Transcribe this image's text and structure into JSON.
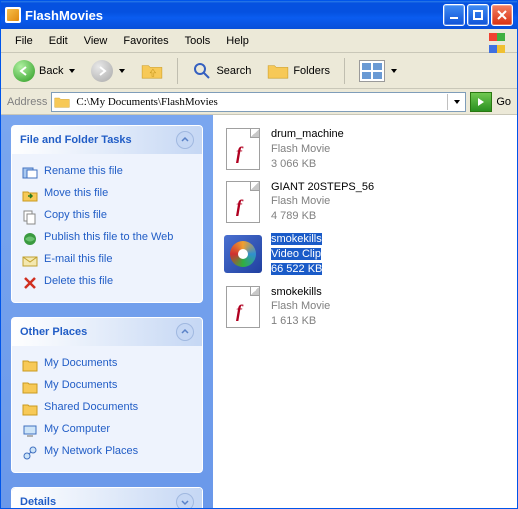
{
  "window": {
    "title": "FlashMovies"
  },
  "menubar": {
    "items": [
      "File",
      "Edit",
      "View",
      "Favorites",
      "Tools",
      "Help"
    ]
  },
  "toolbar": {
    "back_label": "Back",
    "search_label": "Search",
    "folders_label": "Folders"
  },
  "addressbar": {
    "label": "Address",
    "path": "C:\\My Documents\\FlashMovies",
    "go_label": "Go"
  },
  "sidebar": {
    "tasks": {
      "title": "File and Folder Tasks",
      "items": [
        {
          "label": "Rename this file",
          "icon": "rename"
        },
        {
          "label": "Move this file",
          "icon": "move"
        },
        {
          "label": "Copy this file",
          "icon": "copy"
        },
        {
          "label": "Publish this file to the Web",
          "icon": "publish"
        },
        {
          "label": "E-mail this file",
          "icon": "email"
        },
        {
          "label": "Delete this file",
          "icon": "delete"
        }
      ]
    },
    "places": {
      "title": "Other Places",
      "items": [
        {
          "label": "My Documents",
          "icon": "folder"
        },
        {
          "label": "My Documents",
          "icon": "folder"
        },
        {
          "label": "Shared Documents",
          "icon": "folder"
        },
        {
          "label": "My Computer",
          "icon": "computer"
        },
        {
          "label": "My Network Places",
          "icon": "network"
        }
      ]
    },
    "details": {
      "title": "Details"
    }
  },
  "files": [
    {
      "name": "drum_machine",
      "type": "Flash Movie",
      "size": "3 066 KB",
      "icon": "swf",
      "selected": false
    },
    {
      "name": "GIANT 20STEPS_56",
      "type": "Flash Movie",
      "size": "4 789 KB",
      "icon": "swf",
      "selected": false
    },
    {
      "name": "smokekills",
      "type": "Video Clip",
      "size": "66 522 KB",
      "icon": "wmv",
      "selected": true
    },
    {
      "name": "smokekills",
      "type": "Flash Movie",
      "size": "1 613 KB",
      "icon": "swf",
      "selected": false
    }
  ]
}
